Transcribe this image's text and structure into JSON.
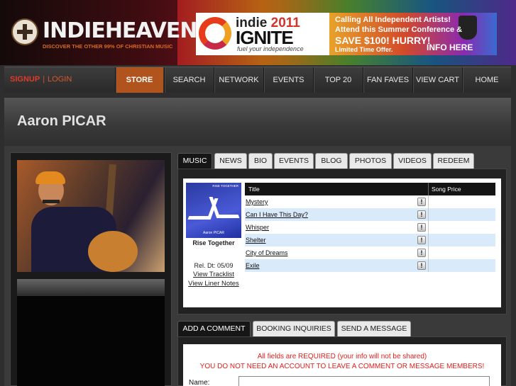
{
  "header": {
    "logo_name": "INDIEHEAVEN",
    "logo_tagline": "DISCOVER THE OTHER 99% OF CHRISTIAN MUSIC",
    "banner": {
      "title_prefix": "indie",
      "title_year": "2011",
      "title_main": "IGNITE",
      "slogan": "fuel your independence",
      "line1": "Calling All Independent Artists!",
      "line2": "Attend this Summer Conference &",
      "line3": "SAVE $100! HURRY!",
      "line4": "Limited Time Offer.",
      "cta": "INFO HERE"
    }
  },
  "nav": {
    "signup": "SIGNUP",
    "separator": "|",
    "login": "LOGIN",
    "items": [
      "STORE",
      "SEARCH",
      "NETWORK",
      "EVENTS",
      "TOP 20",
      "FAN FAVES",
      "VIEW CART",
      "HOME"
    ],
    "active": "STORE"
  },
  "profile": {
    "artist_name": "Aaron PICAR"
  },
  "profile_tabs": [
    "MUSIC",
    "NEWS",
    "BIO",
    "EVENTS",
    "BLOG",
    "PHOTOS",
    "VIDEOS",
    "REDEEM"
  ],
  "profile_tab_active": "MUSIC",
  "album": {
    "cover_top_text": "RISE TOGETHER",
    "cover_bottom_text": "Aaron PICAR",
    "title": "Rise Together",
    "release": "Rel. Dt: 05/09",
    "view_tracklist": "View Tracklist",
    "view_liner_notes": "View Liner Notes"
  },
  "tracks": {
    "col_title": "Title",
    "col_price": "Song Price",
    "info_icon_glyph": "!",
    "rows": [
      "Mystery",
      "Can I Have This Day?",
      "Whisper",
      "Shelter",
      "City of Dreams",
      "Exile"
    ]
  },
  "comment_tabs": [
    "ADD A COMMENT",
    "BOOKING INQUIRIES",
    "SEND A MESSAGE"
  ],
  "comment_tab_active": "ADD A COMMENT",
  "comment_form": {
    "required_note": "All fields are REQUIRED (your info will not be shared)",
    "account_note": "YOU DO NOT NEED AN ACCOUNT TO LEAVE A COMMENT OR MESSAGE MEMBERS!",
    "name_label": "Name:",
    "name_value": ""
  },
  "colors": {
    "accent_orange": "#b0531c",
    "signup_red": "#e03a2a",
    "row_highlight": "#d9eafa",
    "required_red": "#e02020"
  }
}
